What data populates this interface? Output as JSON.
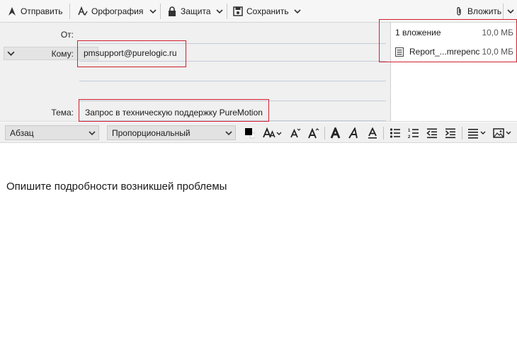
{
  "toolbar": {
    "send_label": "Отправить",
    "spelling_label": "Орфография",
    "security_label": "Защита",
    "save_label": "Сохранить",
    "attach_label": "Вложить"
  },
  "header": {
    "from_label": "От:",
    "to_label": "Кому:",
    "to_value": "pmsupport@purelogic.ru",
    "subject_label": "Тема:",
    "subject_value": "Запрос в техническую поддержку PureMotion"
  },
  "attachments": {
    "summary_label": "1 вложение",
    "summary_size": "10,0 МБ",
    "items": [
      {
        "name": "Report_...mrepenc",
        "size": "10,0 МБ"
      }
    ]
  },
  "format": {
    "paragraph_style": "Абзац",
    "font_family": "Пропорциональный"
  },
  "body": {
    "text": "Опишите подробности возникшей проблемы"
  },
  "colors": {
    "highlight": "#d11f2f",
    "toolbar_bg": "#f6f6f6",
    "header_bg": "#f0f0f0"
  }
}
